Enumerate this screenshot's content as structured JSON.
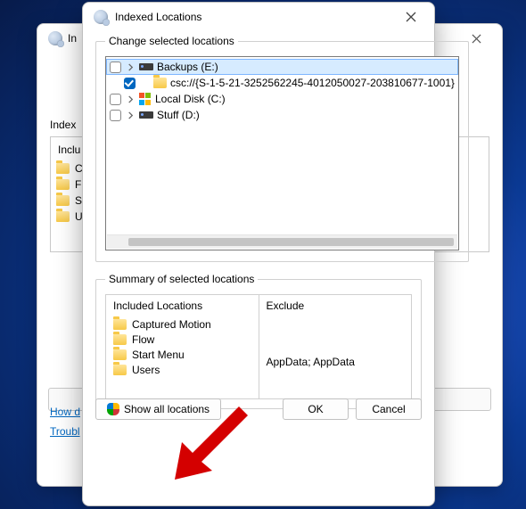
{
  "back_window": {
    "title_prefix": "In",
    "section_label": "Index",
    "list_header": "Inclu",
    "items": [
      "C",
      "F",
      "S",
      "U"
    ],
    "link1": "How d",
    "link2": "Troubl"
  },
  "dialog": {
    "title": "Indexed Locations",
    "groupbox_change": "Change selected locations",
    "groupbox_summary": "Summary of selected locations",
    "tree": [
      {
        "checked": false,
        "expandable": true,
        "icon": "drive-dark",
        "label": "Backups (E:)",
        "selected": true
      },
      {
        "checked": true,
        "expandable": false,
        "icon": "folder",
        "label": "csc://{S-1-5-21-3252562245-4012050027-203810677-1001}",
        "indent": true
      },
      {
        "checked": false,
        "expandable": true,
        "icon": "winvol",
        "label": "Local Disk (C:)"
      },
      {
        "checked": false,
        "expandable": true,
        "icon": "drive-dark",
        "label": "Stuff (D:)"
      }
    ],
    "included_header": "Included Locations",
    "exclude_header": "Exclude",
    "included": [
      "Captured Motion",
      "Flow",
      "Start Menu",
      "Users"
    ],
    "exclude_text": "AppData; AppData",
    "buttons": {
      "show_all": "Show all locations",
      "ok": "OK",
      "cancel": "Cancel"
    }
  }
}
